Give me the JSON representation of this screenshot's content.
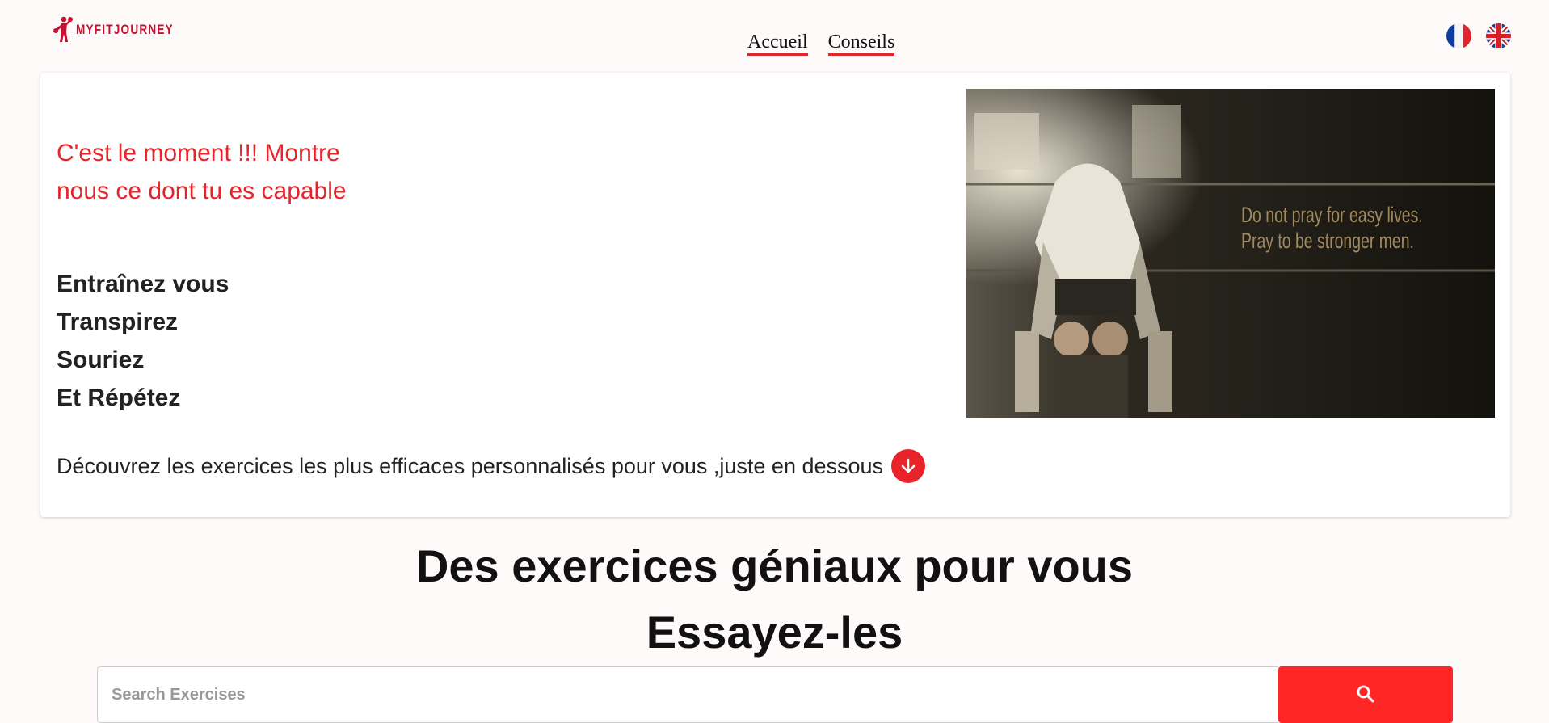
{
  "brand": {
    "name": "MYFITJOURNEY",
    "color": "#c8102e"
  },
  "nav": {
    "home": "Accueil",
    "tips": "Conseils"
  },
  "languages": [
    {
      "code": "fr",
      "icon": "france-flag-icon"
    },
    {
      "code": "en",
      "icon": "uk-flag-icon"
    }
  ],
  "hero": {
    "tagline": "C'est le moment !!! Montre nous ce dont tu es capable",
    "motto": [
      "Entraînez vous",
      "Transpirez",
      "Souriez",
      "Et Répétez"
    ],
    "discover": "Découvrez les exercices les plus efficaces personnalisés pour vous ,juste en dessous",
    "image_quote_line1": "Do not pray for easy lives.",
    "image_quote_line2": "Pray to be stronger men.",
    "accent": "#e8242a"
  },
  "section": {
    "title": "Des exercices géniaux pour vous",
    "subtitle": "Essayez-les"
  },
  "search": {
    "placeholder": "Search Exercises",
    "value": "",
    "button_color": "#ff2625",
    "icon": "search-icon"
  }
}
